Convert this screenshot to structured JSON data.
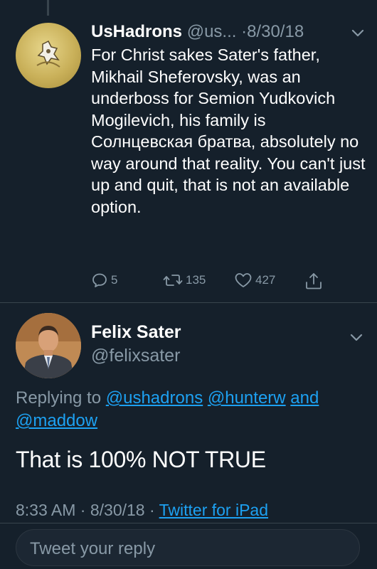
{
  "parent_tweet": {
    "display_name": "UsHadrons",
    "handle": "@us...",
    "date": "·8/30/18",
    "text": "For Christ sakes Sater's father, Mikhail Sheferovsky, was an underboss for Semion Yudkovich Mogilevich, his family is Солнцевская братва, absolutely no way around that reality. You can't just up and quit, that is not an available option.",
    "replies": "5",
    "retweets": "135",
    "likes": "427"
  },
  "main_tweet": {
    "display_name": "Felix Sater",
    "handle": "@felixsater",
    "replying_prefix": "Replying to",
    "mention_1": "@ushadrons",
    "mention_2": "@hunterw",
    "and_word": "and",
    "mention_3": "@maddow",
    "text": "That is 100% NOT TRUE",
    "time": "8:33 AM",
    "sep1": " · ",
    "date": "8/30/18",
    "sep2": " · ",
    "source": "Twitter for iPad"
  },
  "reply_bar": {
    "placeholder": "Tweet your reply"
  },
  "colors": {
    "background": "#15202b",
    "secondary_text": "#8899a6",
    "link": "#1da1f2",
    "divider": "#38444d"
  },
  "icons": {
    "reply": "reply-icon",
    "retweet": "retweet-icon",
    "like": "heart-icon",
    "share": "share-icon",
    "caret": "chevron-down-icon"
  }
}
